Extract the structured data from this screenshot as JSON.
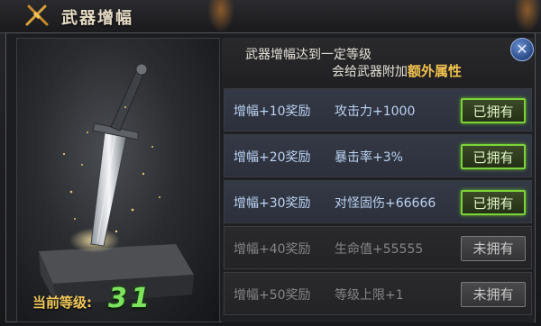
{
  "window": {
    "title": "武器增幅"
  },
  "description": {
    "line1": "武器增幅达到一定等级",
    "line2_prefix": "会给武器附加",
    "line2_highlight": "额外属性"
  },
  "current_level": {
    "label": "当前等级:",
    "value": "31"
  },
  "rewards": [
    {
      "level_label": "增幅+10奖励",
      "effect": "攻击力+1000",
      "status": "已拥有",
      "owned": true
    },
    {
      "level_label": "增幅+20奖励",
      "effect": "暴击率+3%",
      "status": "已拥有",
      "owned": true
    },
    {
      "level_label": "增幅+30奖励",
      "effect": "对怪固伤+66666",
      "status": "已拥有",
      "owned": true
    },
    {
      "level_label": "增幅+40奖励",
      "effect": "生命值+55555",
      "status": "未拥有",
      "owned": false
    },
    {
      "level_label": "增幅+50奖励",
      "effect": "等级上限+1",
      "status": "未拥有",
      "owned": false
    }
  ],
  "icons": {
    "title": "crossed-swords-icon",
    "close": "close-icon"
  },
  "colors": {
    "owned_border": "#7cd43a",
    "level_value": "#7be35d",
    "highlight": "#f2c24f"
  }
}
